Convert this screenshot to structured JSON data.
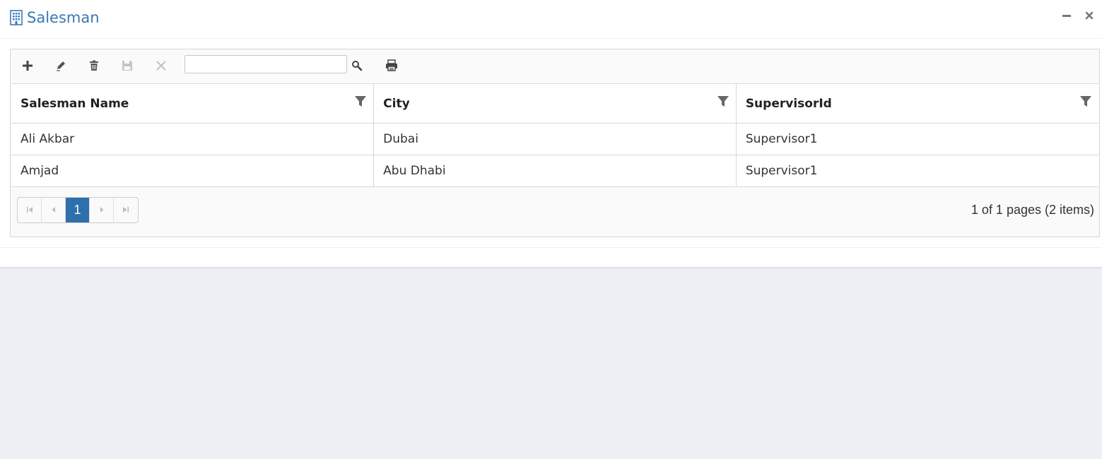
{
  "window": {
    "title": "Salesman",
    "icon": "building-icon",
    "minimize_icon": "minimize-icon",
    "close_icon": "close-icon"
  },
  "toolbar": {
    "buttons": [
      "add-icon",
      "edit-icon",
      "delete-icon",
      "save-icon",
      "cancel-icon"
    ],
    "search_value": "",
    "search_icon": "search-icon",
    "print_icon": "print-icon"
  },
  "table": {
    "columns": [
      "Salesman Name",
      "City",
      "SupervisorId"
    ],
    "rows": [
      [
        "Ali Akbar",
        "Dubai",
        "Supervisor1"
      ],
      [
        "Amjad",
        "Abu Dhabi",
        "Supervisor1"
      ]
    ]
  },
  "pager": {
    "current_page": "1",
    "info": "1 of 1 pages (2 items)"
  },
  "colors": {
    "title": "#3a78b5",
    "pager_active": "#2e6fae",
    "background": "#eceff3"
  }
}
